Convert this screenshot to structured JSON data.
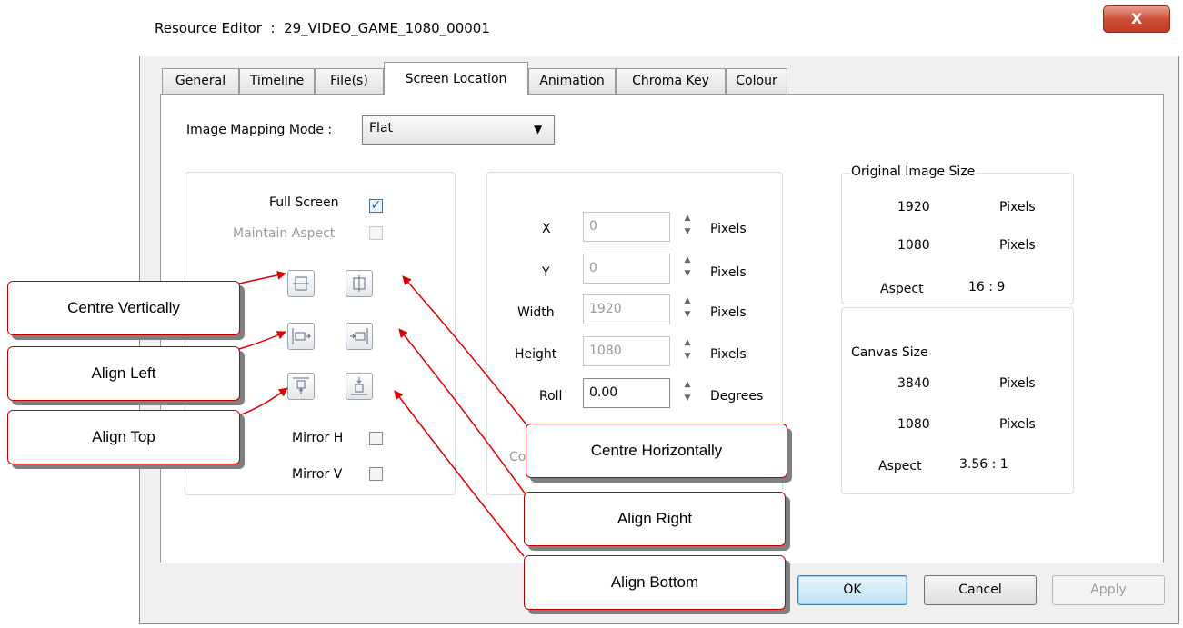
{
  "window": {
    "title": "Resource Editor  :  29_VIDEO_GAME_1080_00001",
    "close_label": "X"
  },
  "tabs": [
    {
      "label": "General",
      "active": false
    },
    {
      "label": "Timeline",
      "active": false
    },
    {
      "label": "File(s)",
      "active": false
    },
    {
      "label": "Screen Location",
      "active": true
    },
    {
      "label": "Animation",
      "active": false
    },
    {
      "label": "Chroma Key",
      "active": false
    },
    {
      "label": "Colour",
      "active": false
    }
  ],
  "mapping": {
    "label": "Image Mapping Mode :",
    "value": "Flat"
  },
  "options": {
    "full_screen": {
      "label": "Full Screen",
      "checked": true
    },
    "maintain_aspect": {
      "label": "Maintain Aspect",
      "checked": false
    },
    "mirror_h": {
      "label": "Mirror H",
      "checked": false
    },
    "mirror_v": {
      "label": "Mirror V",
      "checked": false
    }
  },
  "position": {
    "fields": [
      {
        "label": "X",
        "value": "0",
        "unit": "Pixels"
      },
      {
        "label": "Y",
        "value": "0",
        "unit": "Pixels"
      },
      {
        "label": "Width",
        "value": "1920",
        "unit": "Pixels"
      },
      {
        "label": "Height",
        "value": "1080",
        "unit": "Pixels"
      },
      {
        "label": "Roll",
        "value": "0.00",
        "unit": "Degrees"
      }
    ],
    "partial_label": "Co"
  },
  "original_size": {
    "title": "Original Image Size",
    "width": "1920",
    "height": "1080",
    "unit": "Pixels",
    "aspect_label": "Aspect",
    "aspect_value": "16 : 9"
  },
  "canvas_size": {
    "title": "Canvas Size",
    "width": "3840",
    "height": "1080",
    "unit": "Pixels",
    "aspect_label": "Aspect",
    "aspect_value": "3.56 : 1"
  },
  "buttons": {
    "ok": "OK",
    "cancel": "Cancel",
    "apply": "Apply"
  },
  "callouts": {
    "centre_vertically": "Centre Vertically",
    "align_left": "Align Left",
    "align_top": "Align Top",
    "centre_horizontally": "Centre Horizontally",
    "align_right": "Align Right",
    "align_bottom": "Align Bottom"
  },
  "colors": {
    "callout_border": "#c00000",
    "arrow": "#e00000",
    "default_button": "#3c7fb1"
  }
}
